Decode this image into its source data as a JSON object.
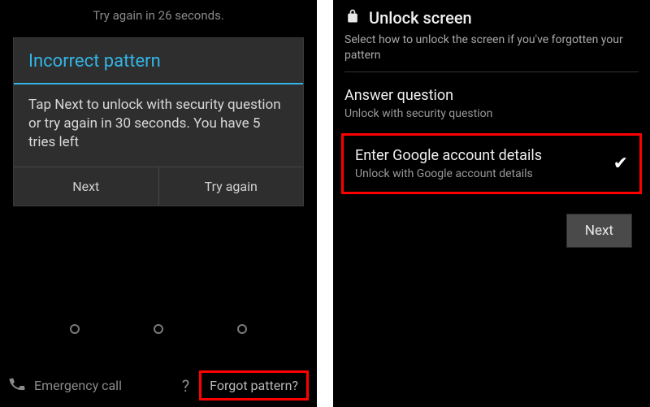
{
  "left": {
    "retry_notice": "Try again in 26 seconds.",
    "dialog": {
      "title": "Incorrect pattern",
      "body": "Tap Next to unlock with security question or try again in 30 seconds. You have 5 tries left",
      "next_label": "Next",
      "tryagain_label": "Try again"
    },
    "emergency_label": "Emergency call",
    "help_label": "?",
    "forgot_label": "Forgot pattern?"
  },
  "right": {
    "header_title": "Unlock screen",
    "header_sub": "Select how to unlock the screen if you've forgotten your pattern",
    "option1": {
      "title": "Answer question",
      "sub": "Unlock with security question"
    },
    "option2": {
      "title": "Enter Google account details",
      "sub": "Unlock with Google account details"
    },
    "next_label": "Next"
  }
}
